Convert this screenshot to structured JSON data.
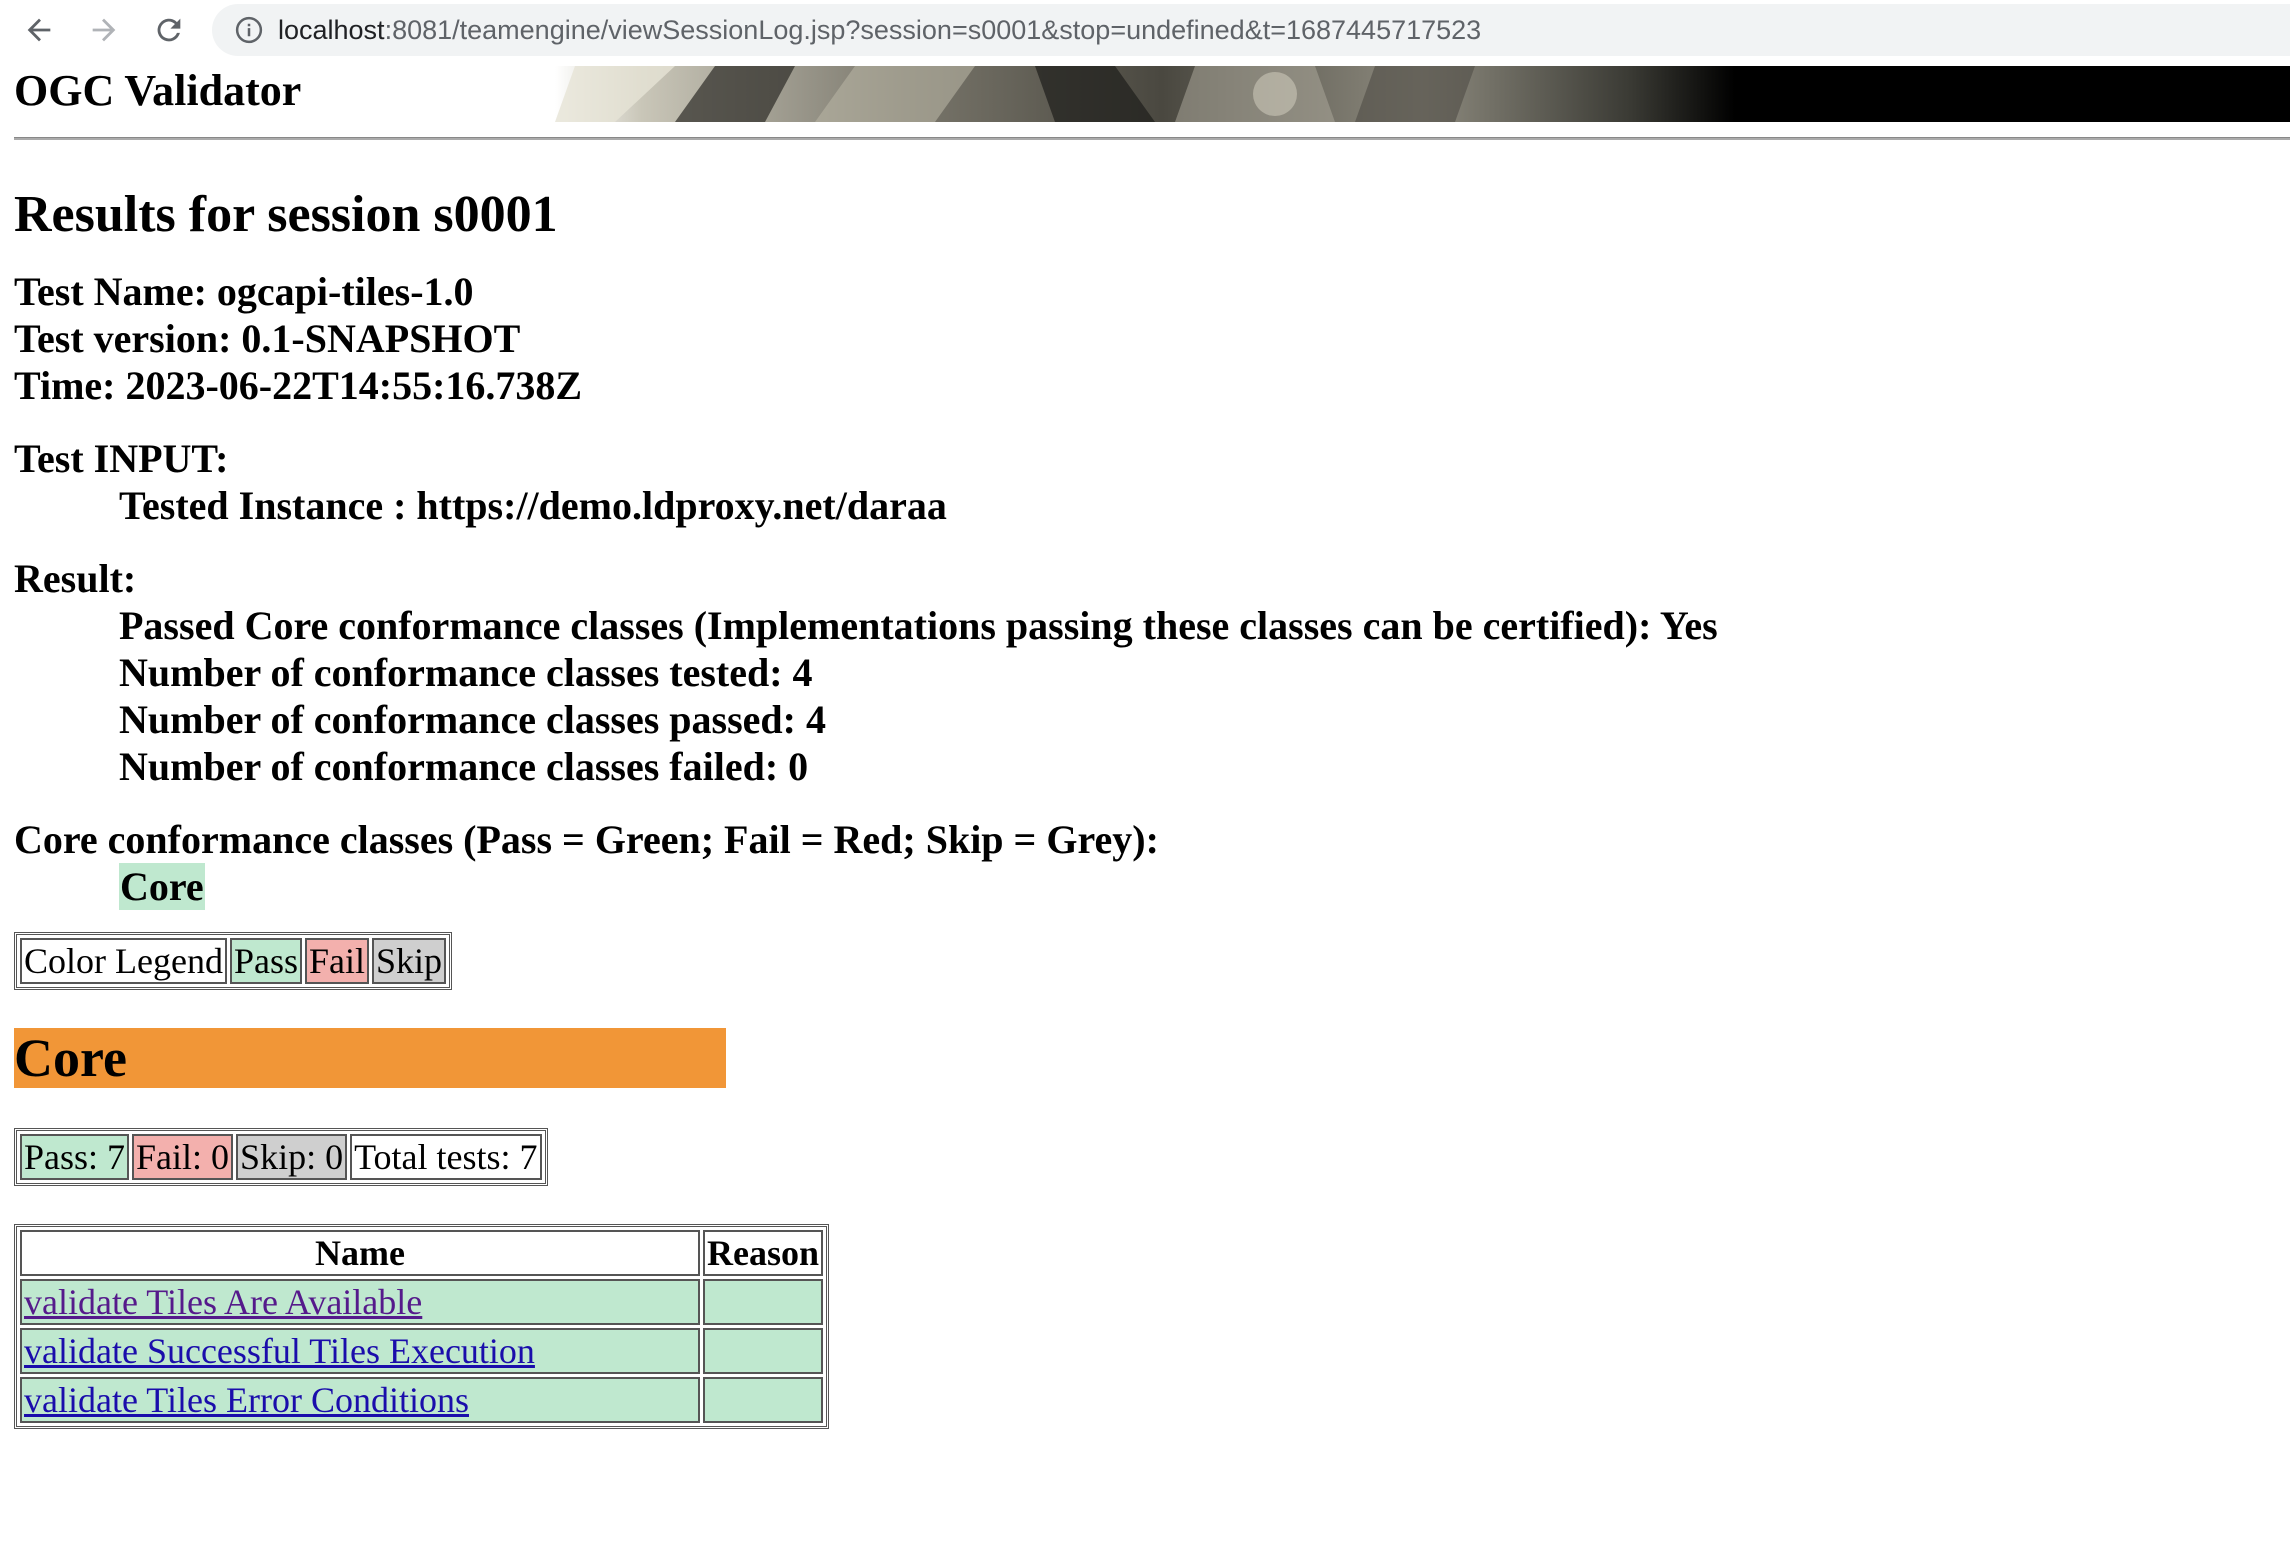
{
  "browser": {
    "url_host": "localhost",
    "url_rest": ":8081/teamengine/viewSessionLog.jsp?session=s0001&stop=undefined&t=1687445717523"
  },
  "header": {
    "site_title": "OGC Validator"
  },
  "session": {
    "heading": "Results for session s0001",
    "test_name": "Test Name: ogcapi-tiles-1.0",
    "test_version": "Test version: 0.1-SNAPSHOT",
    "time": "Time: 2023-06-22T14:55:16.738Z"
  },
  "input": {
    "label": "Test INPUT:",
    "tested_instance": "Tested Instance : https://demo.ldproxy.net/daraa"
  },
  "result": {
    "label": "Result:",
    "passed_core": "Passed Core conformance classes (Implementations passing these classes can be certified): Yes",
    "tested": "Number of conformance classes tested: 4",
    "passed": "Number of conformance classes passed: 4",
    "failed": "Number of conformance classes failed: 0"
  },
  "core_classes": {
    "label": "Core conformance classes (Pass = Green; Fail = Red; Skip = Grey):",
    "items": [
      "Core"
    ]
  },
  "legend": {
    "title": "Color Legend",
    "pass": "Pass",
    "fail": "Fail",
    "skip": "Skip"
  },
  "colors": {
    "pass": "#bfe8cf",
    "fail": "#f3b0ad",
    "skip": "#cfcfcf",
    "section": "#f19637"
  },
  "core_section": {
    "heading": "Core",
    "summary": {
      "pass": "Pass: 7",
      "fail": "Fail: 0",
      "skip": "Skip: 0",
      "total": "Total tests: 7"
    },
    "table": {
      "headers": [
        "Name",
        "Reason"
      ],
      "rows": [
        {
          "name": "validate Tiles Are Available",
          "reason": ""
        },
        {
          "name": "validate Successful Tiles Execution",
          "reason": ""
        },
        {
          "name": "validate Tiles Error Conditions",
          "reason": ""
        }
      ]
    }
  }
}
